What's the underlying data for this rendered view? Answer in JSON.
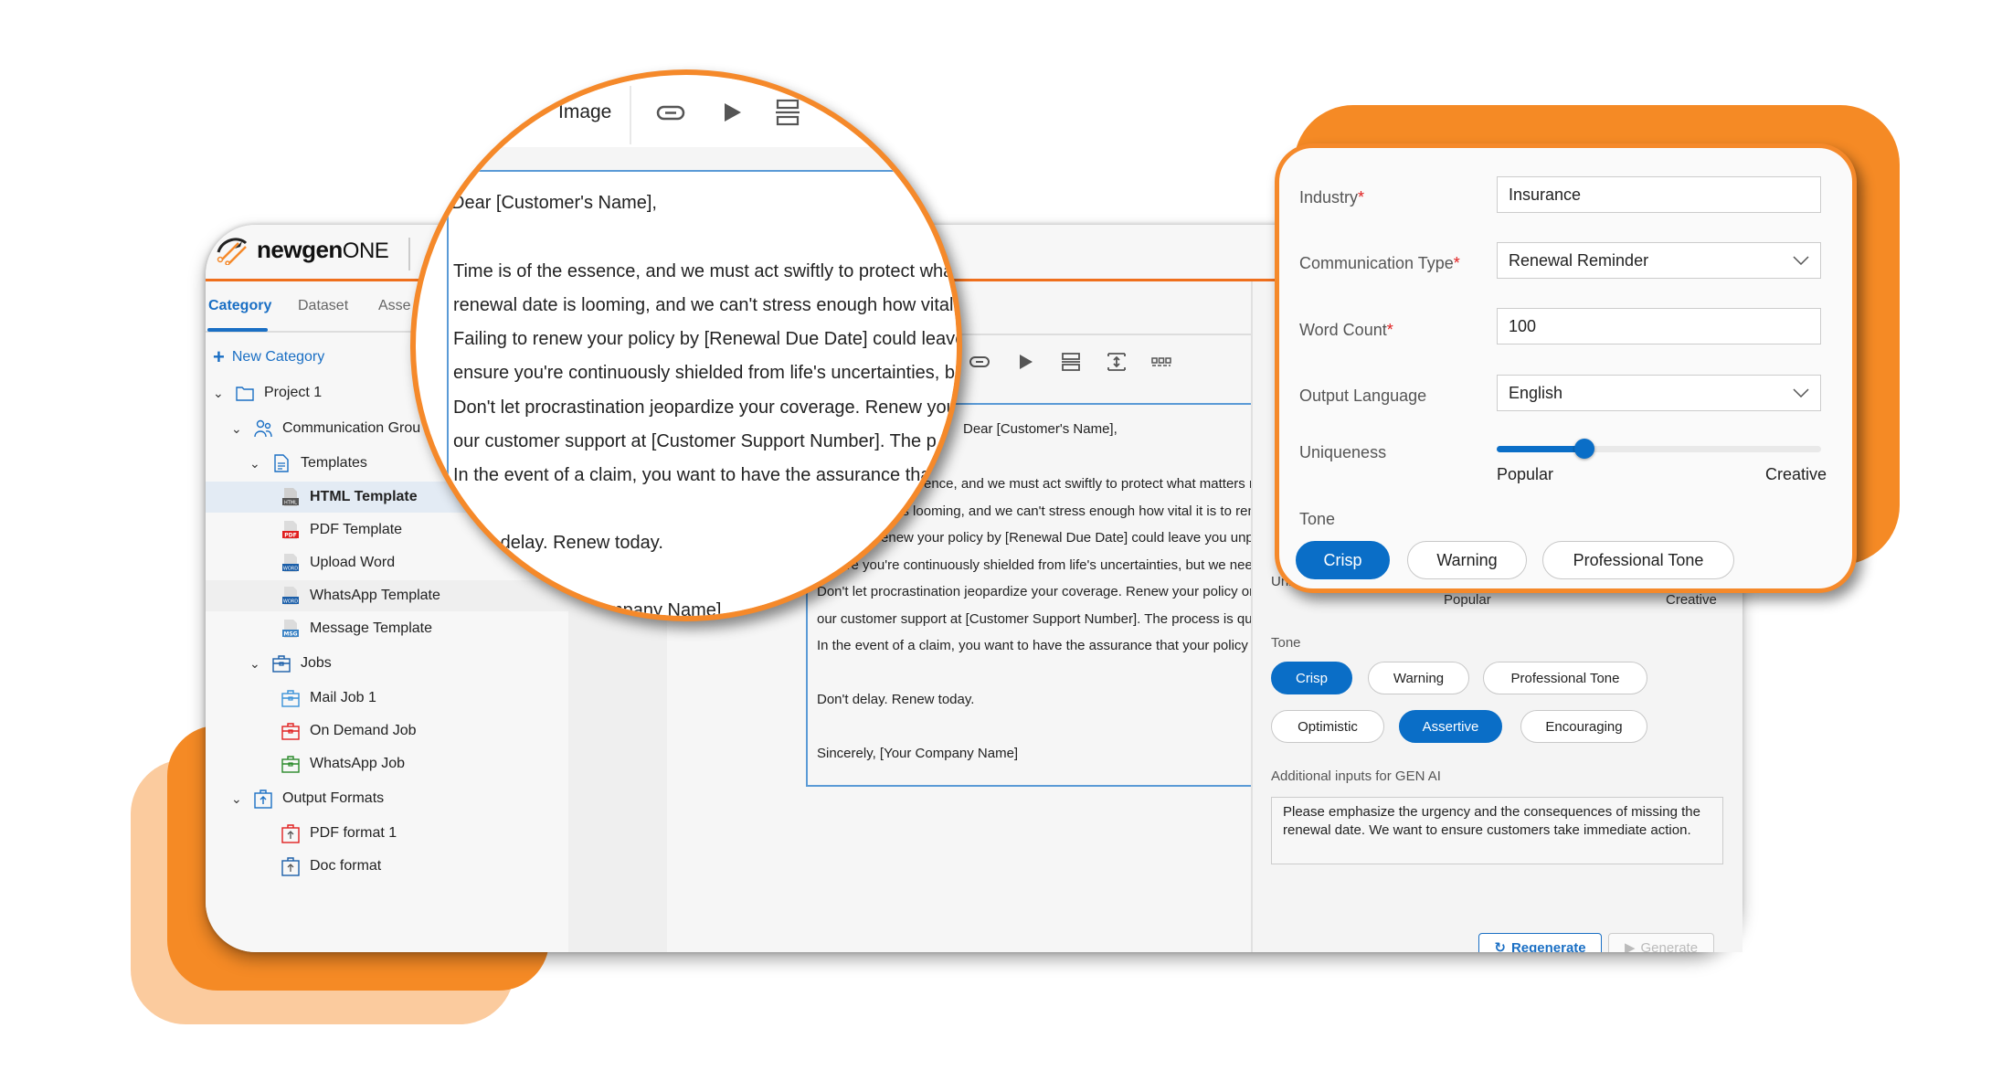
{
  "brand": {
    "name_bold": "newgen",
    "name_light": "ONE",
    "accent": "#f5892a",
    "primary": "#0a6ec7"
  },
  "sidebar": {
    "tabs": [
      {
        "label": "Category",
        "active": true
      },
      {
        "label": "Dataset"
      },
      {
        "label": "Asse"
      }
    ],
    "new_category_label": "New Category",
    "tree": [
      {
        "label": "Project 1",
        "icon": "folder-icon",
        "level": 0,
        "expanded": true
      },
      {
        "label": "Communication Grou",
        "icon": "users-icon",
        "level": 1,
        "expanded": true
      },
      {
        "label": "Templates",
        "icon": "document-icon",
        "level": 2,
        "expanded": true
      },
      {
        "label": "HTML Template",
        "icon": "html-file-icon",
        "level": 3,
        "selected": true
      },
      {
        "label": "PDF Template",
        "icon": "pdf-file-icon",
        "level": 3
      },
      {
        "label": "Upload Word",
        "icon": "word-upload-icon",
        "level": 3
      },
      {
        "label": "WhatsApp Template",
        "icon": "word-file-icon",
        "level": 3,
        "hover": true
      },
      {
        "label": "Message Template",
        "icon": "msg-file-icon",
        "level": 3
      },
      {
        "label": "Jobs",
        "icon": "briefcase-icon",
        "level": 2,
        "expanded": true
      },
      {
        "label": "Mail Job 1",
        "icon": "briefcase-blue-icon",
        "level": 3
      },
      {
        "label": "On Demand Job",
        "icon": "briefcase-red-icon",
        "level": 3
      },
      {
        "label": "WhatsApp Job",
        "icon": "briefcase-green-icon",
        "level": 3
      },
      {
        "label": "Output Formats",
        "icon": "output-icon",
        "level": 1,
        "expanded": true
      },
      {
        "label": "PDF format 1",
        "icon": "output-red-icon",
        "level": 3
      },
      {
        "label": "Doc format",
        "icon": "output-blue-icon",
        "level": 3
      }
    ]
  },
  "editor": {
    "toolbar": {
      "image_label": "Image"
    },
    "lines": [
      "Dear [Customer's Name],",
      "",
      "Time is of the essence, and we must act swiftly to protect what matters most. Your",
      "renewal date is looming, and we can't stress enough how vital it is to renew now.",
      "Failing to renew your policy by [Renewal Due Date] could leave you unprotected. We want to",
      "ensure you're continuously shielded from life's uncertainties, but we need your action.",
      "Don't let procrastination jeopardize your coverage. Renew your policy online or contact",
      "our customer support at [Customer Support Number]. The process is quick and easy.",
      "In the event of a claim, you want to have the assurance that your policy is active.",
      "",
      "Don't delay. Renew today.",
      "",
      "Sincerely, [Your Company Name]"
    ],
    "magnified_lines": [
      "Dear [Customer's Name],",
      "",
      "Time is of the essence, and we must act swiftly to protect wha",
      "renewal date is looming, and we can't stress enough how vital",
      "Failing to renew your policy by [Renewal Due Date] could leave",
      "ensure you're continuously shielded from life's uncertainties, b",
      "Don't let procrastination jeopardize your coverage. Renew you",
      "our customer support at [Customer Support Number]. The p",
      "In the event of a claim, you want to have the assurance tha",
      "",
      "Don't delay. Renew today.",
      "",
      "Sincerely, [Your Company Name]"
    ]
  },
  "form": {
    "industry": {
      "label": "Industry",
      "required": true,
      "value": "Insurance"
    },
    "communication_type": {
      "label": "Communication Type",
      "required": true,
      "value": "Renewal Reminder"
    },
    "word_count": {
      "label": "Word Count",
      "required": true,
      "value": "100"
    },
    "output_language": {
      "label": "Output Language",
      "value": "English"
    },
    "uniqueness": {
      "label": "Uniqueness",
      "min_label": "Popular",
      "max_label": "Creative",
      "value": 0.27
    },
    "tone": {
      "label": "Tone",
      "options": [
        {
          "label": "Crisp",
          "selected": true
        },
        {
          "label": "Warning",
          "selected": false
        },
        {
          "label": "Professional Tone",
          "selected": false
        },
        {
          "label": "Optimistic",
          "selected": false
        },
        {
          "label": "Assertive",
          "selected": true
        },
        {
          "label": "Encouraging",
          "selected": false
        }
      ]
    },
    "additional_inputs": {
      "label": "Additional inputs for GEN AI",
      "value": "Please emphasize the urgency and the consequences of missing the renewal date. We want to ensure customers take immediate action."
    },
    "background_labels": {
      "uniqueness_short": "Uni",
      "popular": "Popular",
      "creative": "Creative"
    },
    "regenerate_label": "Regenerate",
    "generate_label": "Generate"
  }
}
